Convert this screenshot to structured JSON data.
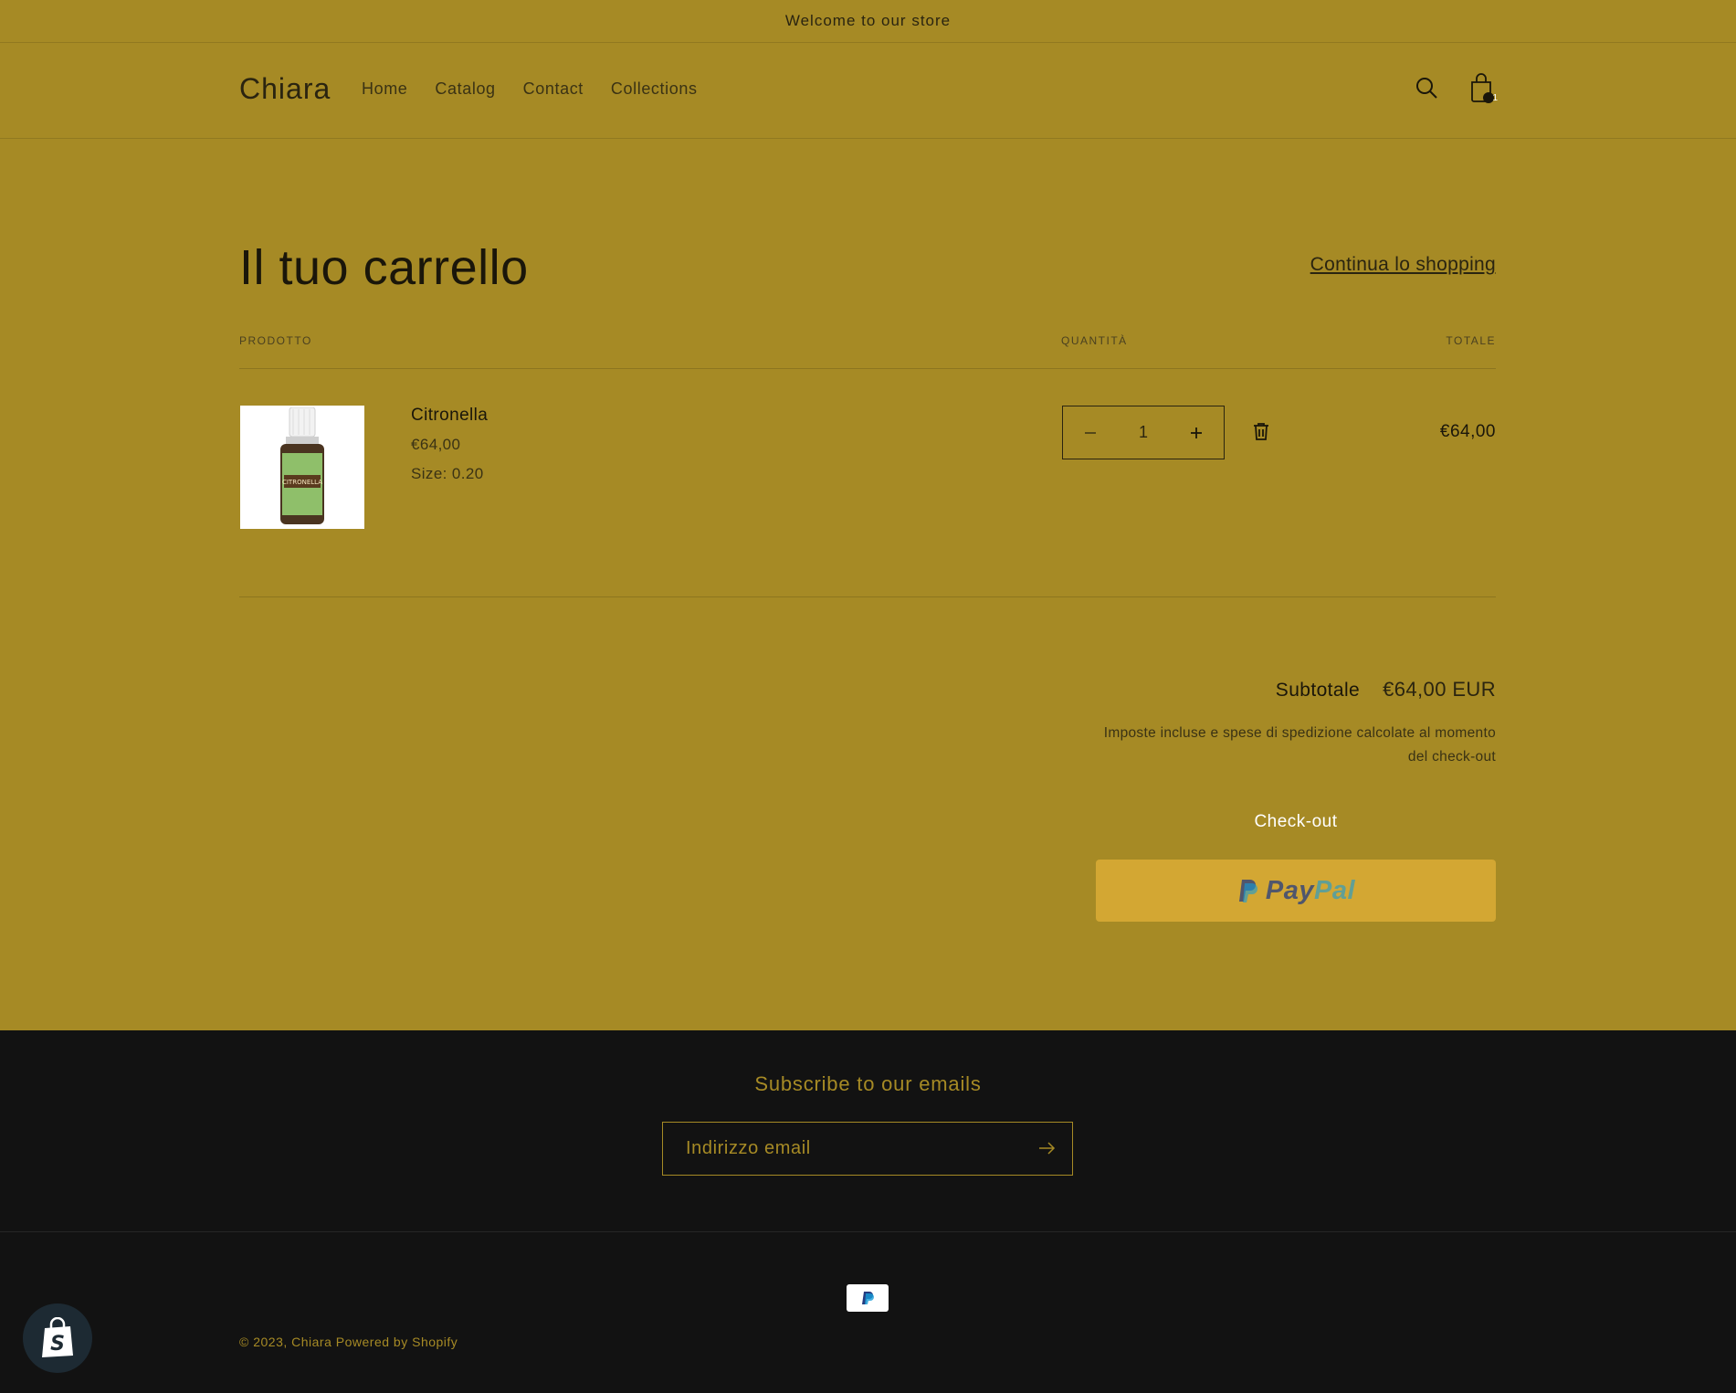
{
  "announcement": {
    "text": "Welcome to our store"
  },
  "header": {
    "logo": "Chiara",
    "nav": [
      "Home",
      "Catalog",
      "Contact",
      "Collections"
    ],
    "cart_count": "1"
  },
  "cart": {
    "title": "Il tuo carrello",
    "continue_label": "Continua lo shopping",
    "columns": {
      "product": "PRODOTTO",
      "quantity": "QUANTITÀ",
      "total": "TOTALE"
    },
    "items": [
      {
        "name": "Citronella",
        "price": "€64,00",
        "size": "Size: 0.20",
        "quantity": "1",
        "line_total": "€64,00",
        "image_label": "CITRONELLA"
      }
    ],
    "subtotal_label": "Subtotale",
    "subtotal_value": "€64,00 EUR",
    "tax_note": "Imposte incluse e spese di spedizione calcolate al momento del check-out",
    "checkout_label": "Check-out",
    "paypal_label_pay": "Pay",
    "paypal_label_pal": "Pal"
  },
  "footer": {
    "subscribe_title": "Subscribe to our emails",
    "email_placeholder": "Indirizzo email",
    "copyright_prefix": "© 2023,",
    "copyright_brand": "Chiara",
    "powered_by": "Powered by Shopify"
  },
  "colors": {
    "background": "#a68a25",
    "footer_bg": "#121212",
    "paypal_button": "#d3a733",
    "text_dark": "#1a160a"
  }
}
